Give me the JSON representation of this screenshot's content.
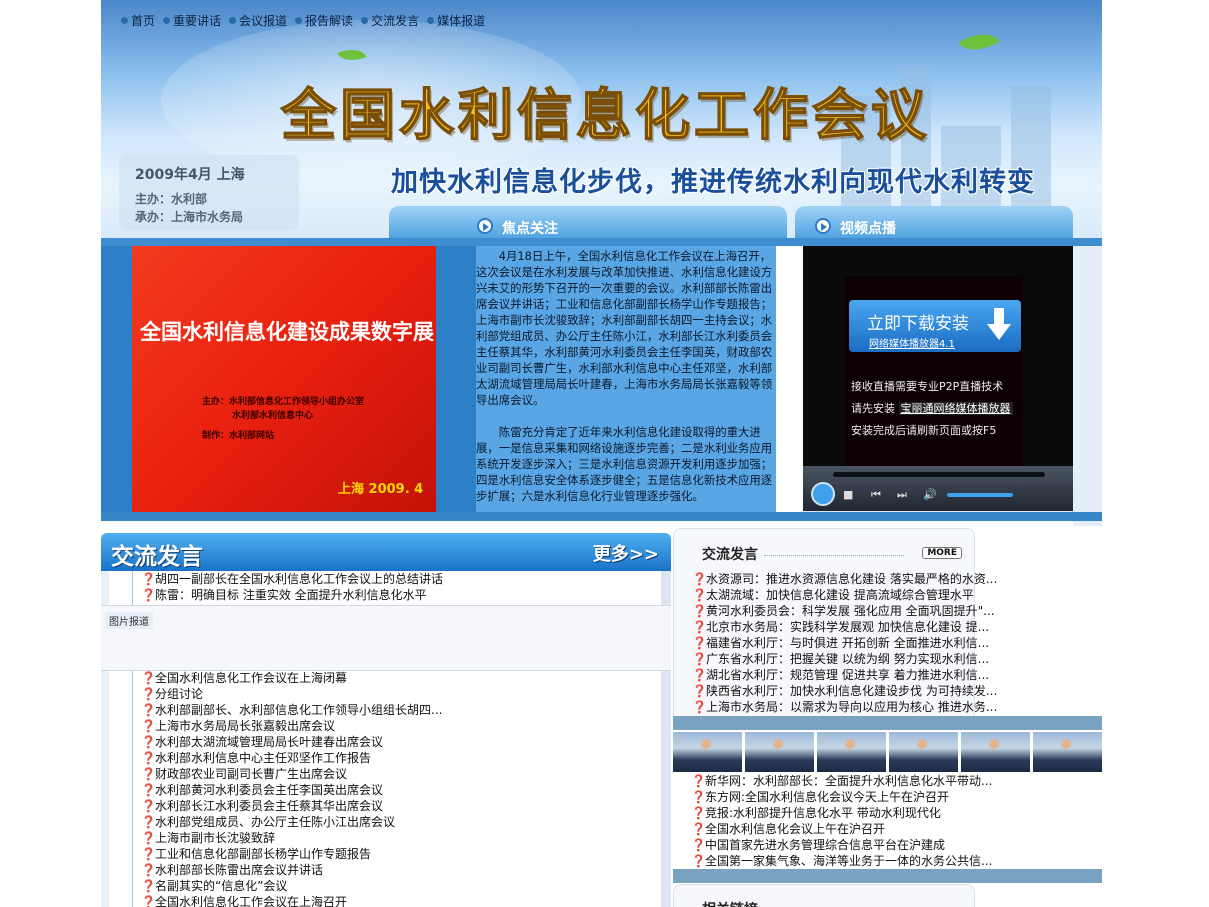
{
  "nav": {
    "items": [
      "首页",
      "重要讲话",
      "会议报道",
      "报告解读",
      "交流发言",
      "媒体报道"
    ]
  },
  "header": {
    "title": "全国水利信息化工作会议",
    "slogan": "加快水利信息化步伐，推进传统水利向现代水利转变",
    "date": "2009年4月 上海",
    "host": "主办：水利部",
    "organizer": "承办：上海市水务局",
    "tab_focus": "焦点关注",
    "tab_video": "视频点播"
  },
  "banner": {
    "title": "全国水利信息化建设成果数字展",
    "host_line1": "主办：水利部信息化工作领导小组办公室",
    "host_line2": "水利部水利信息中心",
    "maker": "制作：水利部网站",
    "date": "上海    2009. 4"
  },
  "article": {
    "p1": "4月18日上午，全国水利信息化工作会议在上海召开，这次会议是在水利发展与改革加快推进、水利信息化建设方兴未艾的形势下召开的一次重要的会议。水利部部长陈雷出席会议并讲话；工业和信息化部副部长杨学山作专题报告；上海市副市长沈骏致辞；水利部副部长胡四一主持会议；水利部党组成员、办公厅主任陈小江，水利部长江水利委员会主任蔡其华，水利部黄河水利委员会主任李国英，财政部农业司副司长曹广生，水利部水利信息中心主任邓坚，水利部太湖流域管理局局长叶建春，上海市水务局局长张嘉毅等领导出席会议。",
    "p2": "陈雷充分肯定了近年来水利信息化建设取得的重大进展，一是信息采集和网络设施逐步完善；二是水利业务应用系统开发逐步深入；三是水利信息资源开发利用逐步加强；四是水利信息安全体系逐步健全；五是信息化新技术应用逐步扩展；六是水利信息化行业管理逐步强化。"
  },
  "video": {
    "download_label": "立即下载安装",
    "player_name": "网络媒体播放器4.1",
    "line1": "接收直播需要专业P2P直播技术",
    "line2_prefix": "请先安装",
    "line2_link": "宝丽通网络媒体播放器",
    "line3": "安装完成后请刷新页面或按F5"
  },
  "exchange": {
    "heading": "交流发言",
    "more": "更多>>",
    "items": [
      "胡四一副部长在全国水利信息化工作会议上的总结讲话",
      "陈雷：明确目标 注重实效 全面提升水利信息化水平"
    ]
  },
  "photo_strip": {
    "tab": "图片报道"
  },
  "reports": {
    "items": [
      "全国水利信息化工作会议在上海闭幕",
      "分组讨论",
      "水利部副部长、水利部信息化工作领导小组组长胡四...",
      "上海市水务局局长张嘉毅出席会议",
      "水利部太湖流域管理局局长叶建春出席会议",
      "水利部水利信息中心主任邓坚作工作报告",
      "财政部农业司副司长曹广生出席会议",
      "水利部黄河水利委员会主任李国英出席会议",
      "水利部长江水利委员会主任蔡其华出席会议",
      "水利部党组成员、办公厅主任陈小江出席会议",
      "上海市副市长沈骏致辞",
      "工业和信息化部副部长杨学山作专题报告",
      "水利部部长陈雷出席会议并讲话",
      "名副其实的“信息化”会议",
      "全国水利信息化工作会议在上海召开"
    ]
  },
  "right_panel": {
    "heading": "交流发言",
    "more": "MORE",
    "items": [
      "水资源司：推进水资源信息化建设 落实最严格的水资...",
      "太湖流域：加快信息化建设 提高流域综合管理水平",
      "黄河水利委员会：科学发展 强化应用 全面巩固提升\"...",
      "北京市水务局：实践科学发展观 加快信息化建设 提...",
      "福建省水利厅：与时俱进 开拓创新 全面推进水利信...",
      "广东省水利厅：把握关键 以统为纲 努力实现水利信...",
      "湖北省水利厅：规范管理 促进共享 着力推进水利信...",
      "陕西省水利厅：加快水利信息化建设步伐 为可持续发...",
      "上海市水务局：以需求为导向以应用为核心 推进水务..."
    ]
  },
  "media": {
    "items": [
      "新华网：水利部部长：全面提升水利信息化水平带动...",
      "东方网:全国水利信息化会议今天上午在沪召开",
      "竞报:水利部提升信息化水平 带动水利现代化",
      "全国水利信息化会议上午在沪召开",
      "中国首家先进水务管理综合信息平台在沪建成",
      "全国第一家集气象、海洋等业务于一体的水务公共信..."
    ]
  },
  "related": {
    "heading": "相关链接"
  },
  "colors": {
    "accent_blue": "#2d7fc7",
    "title_gold": "#f5c11c",
    "banner_red": "#e8200f"
  }
}
